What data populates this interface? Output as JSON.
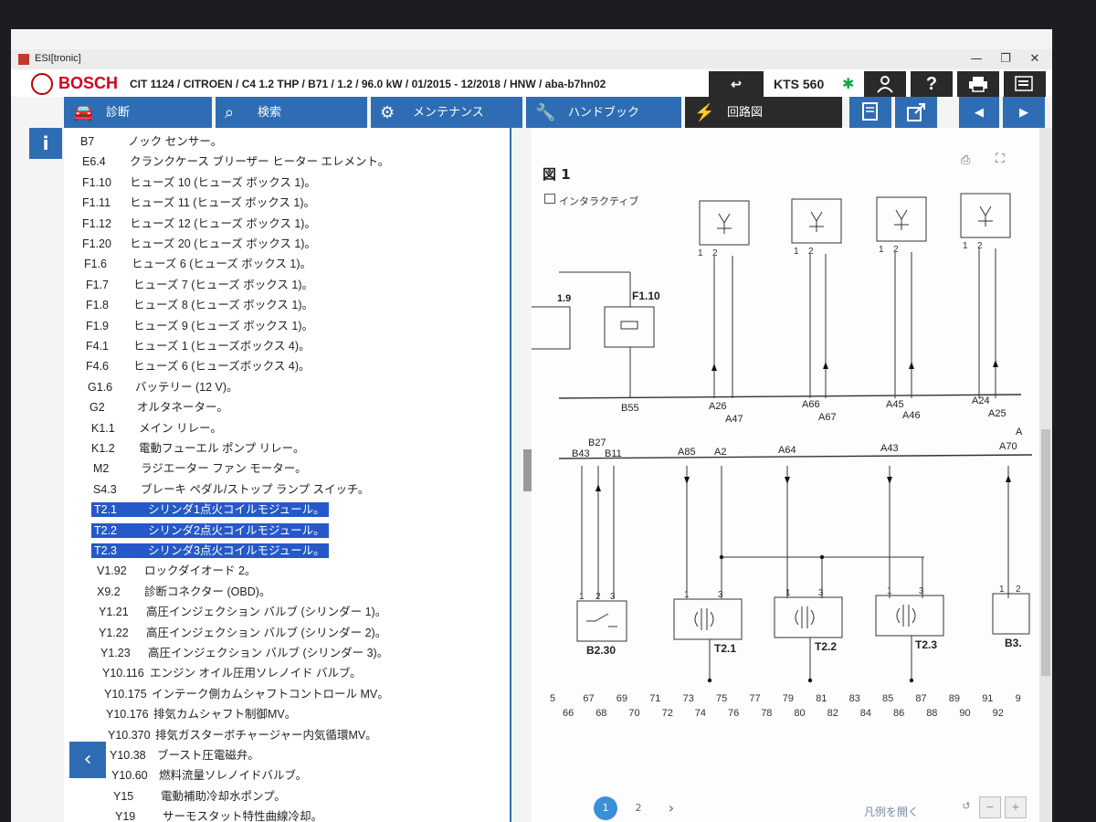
{
  "window": {
    "title": "ESI[tronic]",
    "minimize": "—",
    "maximize": "❐",
    "close": "✕"
  },
  "header": {
    "brand": "BOSCH",
    "vehicle": "CIT 1124 / CITROEN / C4 1.2 THP / B71 / 1.2 / 96.0 kW / 01/2015 - 12/2018 / HNW / aba-b7hn02",
    "device": "KTS 560",
    "back_icon": "↩",
    "user_icon": "user-icon",
    "help_label": "?",
    "print_icon": "print-icon",
    "menu_icon": "menu-icon"
  },
  "nav": {
    "info_label": "i",
    "diagnosis": "診断",
    "search": "検索",
    "maintenance": "メンテナンス",
    "handbook": "ハンドブック",
    "wiring": "回路図",
    "book_icon": "book-icon",
    "external_icon": "external-link-icon",
    "prev_icon": "◀",
    "next_icon": "▶"
  },
  "components": [
    {
      "code": "B7",
      "desc": "ノック センサー。"
    },
    {
      "code": "E6.4",
      "desc": "クランクケース ブリーザー ヒーター エレメント。"
    },
    {
      "code": "F1.10",
      "desc": "ヒューズ 10 (ヒューズ ボックス 1)。"
    },
    {
      "code": "F1.11",
      "desc": "ヒューズ 11 (ヒューズ ボックス 1)。"
    },
    {
      "code": "F1.12",
      "desc": "ヒューズ 12 (ヒューズ ボックス 1)。"
    },
    {
      "code": "F1.20",
      "desc": "ヒューズ 20 (ヒューズ ボックス 1)。"
    },
    {
      "code": "F1.6",
      "desc": "ヒューズ 6 (ヒューズ ボックス 1)。"
    },
    {
      "code": "F1.7",
      "desc": "ヒューズ 7 (ヒューズ ボックス 1)。"
    },
    {
      "code": "F1.8",
      "desc": "ヒューズ 8 (ヒューズ ボックス 1)。"
    },
    {
      "code": "F1.9",
      "desc": "ヒューズ 9 (ヒューズ ボックス 1)。"
    },
    {
      "code": "F4.1",
      "desc": "ヒューズ 1 (ヒューズボックス 4)。"
    },
    {
      "code": "F4.6",
      "desc": "ヒューズ 6 (ヒューズボックス 4)。"
    },
    {
      "code": "G1.6",
      "desc": "バッテリー (12 V)。"
    },
    {
      "code": "G2",
      "desc": "オルタネーター。"
    },
    {
      "code": "K1.1",
      "desc": "メイン リレー。"
    },
    {
      "code": "K1.2",
      "desc": "電動フューエル ポンプ リレー。"
    },
    {
      "code": "M2",
      "desc": "ラジエーター ファン モーター。"
    },
    {
      "code": "S4.3",
      "desc": "ブレーキ ペダル/ストップ ランプ スイッチ。"
    },
    {
      "code": "T2.1",
      "desc": "シリンダ1点火コイルモジュール。",
      "selected": true
    },
    {
      "code": "T2.2",
      "desc": "シリンダ2点火コイルモジュール。",
      "selected": true
    },
    {
      "code": "T2.3",
      "desc": "シリンダ3点火コイルモジュール。",
      "selected": true
    },
    {
      "code": "V1.92",
      "desc": "ロックダイオード 2。"
    },
    {
      "code": "X9.2",
      "desc": "診断コネクター (OBD)。"
    },
    {
      "code": "Y1.21",
      "desc": "高圧インジェクション バルブ (シリンダー 1)。"
    },
    {
      "code": "Y1.22",
      "desc": "高圧インジェクション バルブ (シリンダー 2)。"
    },
    {
      "code": "Y1.23",
      "desc": "高圧インジェクション バルブ (シリンダー 3)。"
    },
    {
      "code": "Y10.116",
      "desc": "エンジン オイル圧用ソレノイド バルブ。"
    },
    {
      "code": "Y10.175",
      "desc": "インテーク側カムシャフトコントロール MV。"
    },
    {
      "code": "Y10.176",
      "desc": "排気カムシャフト制御MV。"
    },
    {
      "code": "Y10.370",
      "desc": "排気ガスターボチャージャー内気循環MV。"
    },
    {
      "code": "Y10.38",
      "desc": "ブースト圧電磁弁。"
    },
    {
      "code": "Y10.60",
      "desc": "燃料流量ソレノイドバルブ。"
    },
    {
      "code": "Y15",
      "desc": "電動補助冷却水ポンプ。"
    },
    {
      "code": "Y19",
      "desc": "サーモスタット特性曲線冷却。"
    }
  ],
  "diagram": {
    "title": "図 1",
    "interactive_label": "インタラクティブ",
    "labels_top": [
      "1.9",
      "F1.10",
      "B55",
      "A26",
      "A47",
      "A66",
      "A67",
      "A45",
      "A46",
      "A24",
      "A25"
    ],
    "labels_mid": [
      "B27",
      "B43",
      "B11",
      "A85",
      "A2",
      "A64",
      "A43",
      "A70",
      "A"
    ],
    "labels_comp": [
      "B2.30",
      "T2.1",
      "T2.2",
      "T2.3",
      "B3."
    ],
    "pin_labels": [
      "1",
      "2",
      "3"
    ],
    "grid_top": [
      "5",
      "67",
      "69",
      "71",
      "73",
      "75",
      "77",
      "79",
      "81",
      "83",
      "85",
      "87",
      "89",
      "91",
      "9"
    ],
    "grid_bottom": [
      "66",
      "68",
      "70",
      "72",
      "74",
      "76",
      "78",
      "80",
      "82",
      "84",
      "86",
      "88",
      "90",
      "92"
    ]
  },
  "pager": {
    "page1": "1",
    "page2": "2",
    "next": "›",
    "legend": "凡例を開く",
    "zoom_out": "−",
    "zoom_in": "+"
  }
}
